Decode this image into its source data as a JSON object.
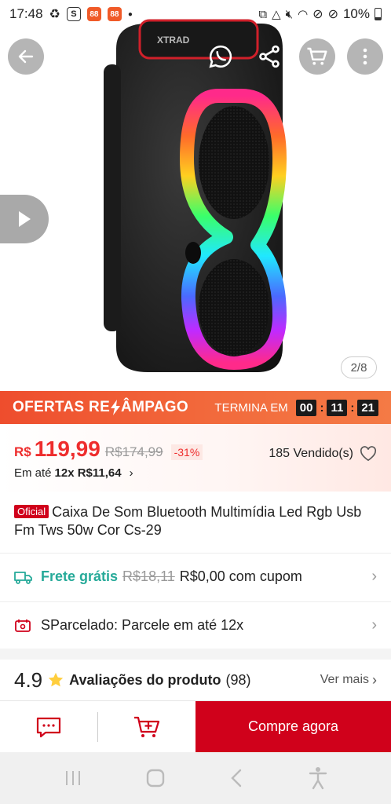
{
  "status_bar": {
    "time": "17:48",
    "battery": "10%"
  },
  "hero": {
    "image_counter": "2/8",
    "speaker_brand": "XTRAD"
  },
  "flash_sale": {
    "title_part1": "OFERTAS RE",
    "title_part2": "ÂMPAGO",
    "ends_label": "TERMINA EM",
    "hours": "00",
    "minutes": "11",
    "seconds": "21"
  },
  "price": {
    "currency": "R$",
    "current": "119,99",
    "original": "R$174,99",
    "discount": "-31%",
    "sold": "185 Vendido(s)",
    "installment_prefix": "Em até",
    "installment_value": "12x R$11,64"
  },
  "product": {
    "badge": "Oficial",
    "title": "Caixa De Som Bluetooth Multimídia Led Rgb Usb Fm Tws 50w Cor Cs-29"
  },
  "shipping": {
    "free_label": "Frete grátis",
    "old_price": "R$18,11",
    "coupon_text": "R$0,00 com cupom"
  },
  "installment_row": {
    "text": "SParcelado: Parcele em até 12x"
  },
  "reviews": {
    "rating": "4.9",
    "title": "Avaliações do produto",
    "count": "(98)",
    "see_more": "Ver mais"
  },
  "bottom_bar": {
    "buy_label": "Compre agora"
  },
  "colors": {
    "brand_red": "#d0011b",
    "flash_orange": "#ee4d2d",
    "free_shipping_green": "#26aa99"
  }
}
